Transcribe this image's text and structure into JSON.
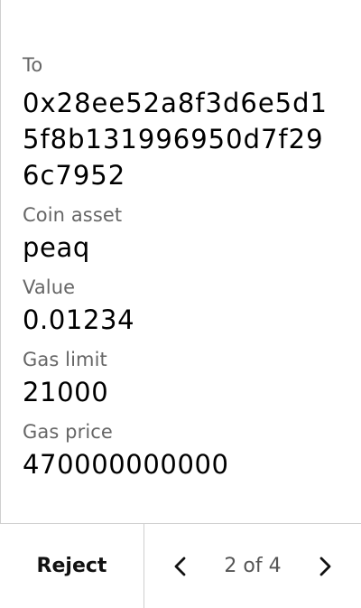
{
  "transaction": {
    "to_label": "To",
    "to_value": "0x28ee52a8f3d6e5d15f8b131996950d7f296c7952",
    "coin_label": "Coin asset",
    "coin_value": "peaq",
    "amount_label": "Value",
    "amount_value": "0.01234",
    "gas_limit_label": "Gas limit",
    "gas_limit_value": "21000",
    "gas_price_label": "Gas price",
    "gas_price_value": "470000000000"
  },
  "footer": {
    "reject_label": "Reject",
    "page_indicator": "2 of 4",
    "prev_icon": "chevron-left-icon",
    "next_icon": "chevron-right-icon"
  },
  "colors": {
    "text": "#000000",
    "label": "#666666",
    "divider": "#cfcfcf"
  }
}
